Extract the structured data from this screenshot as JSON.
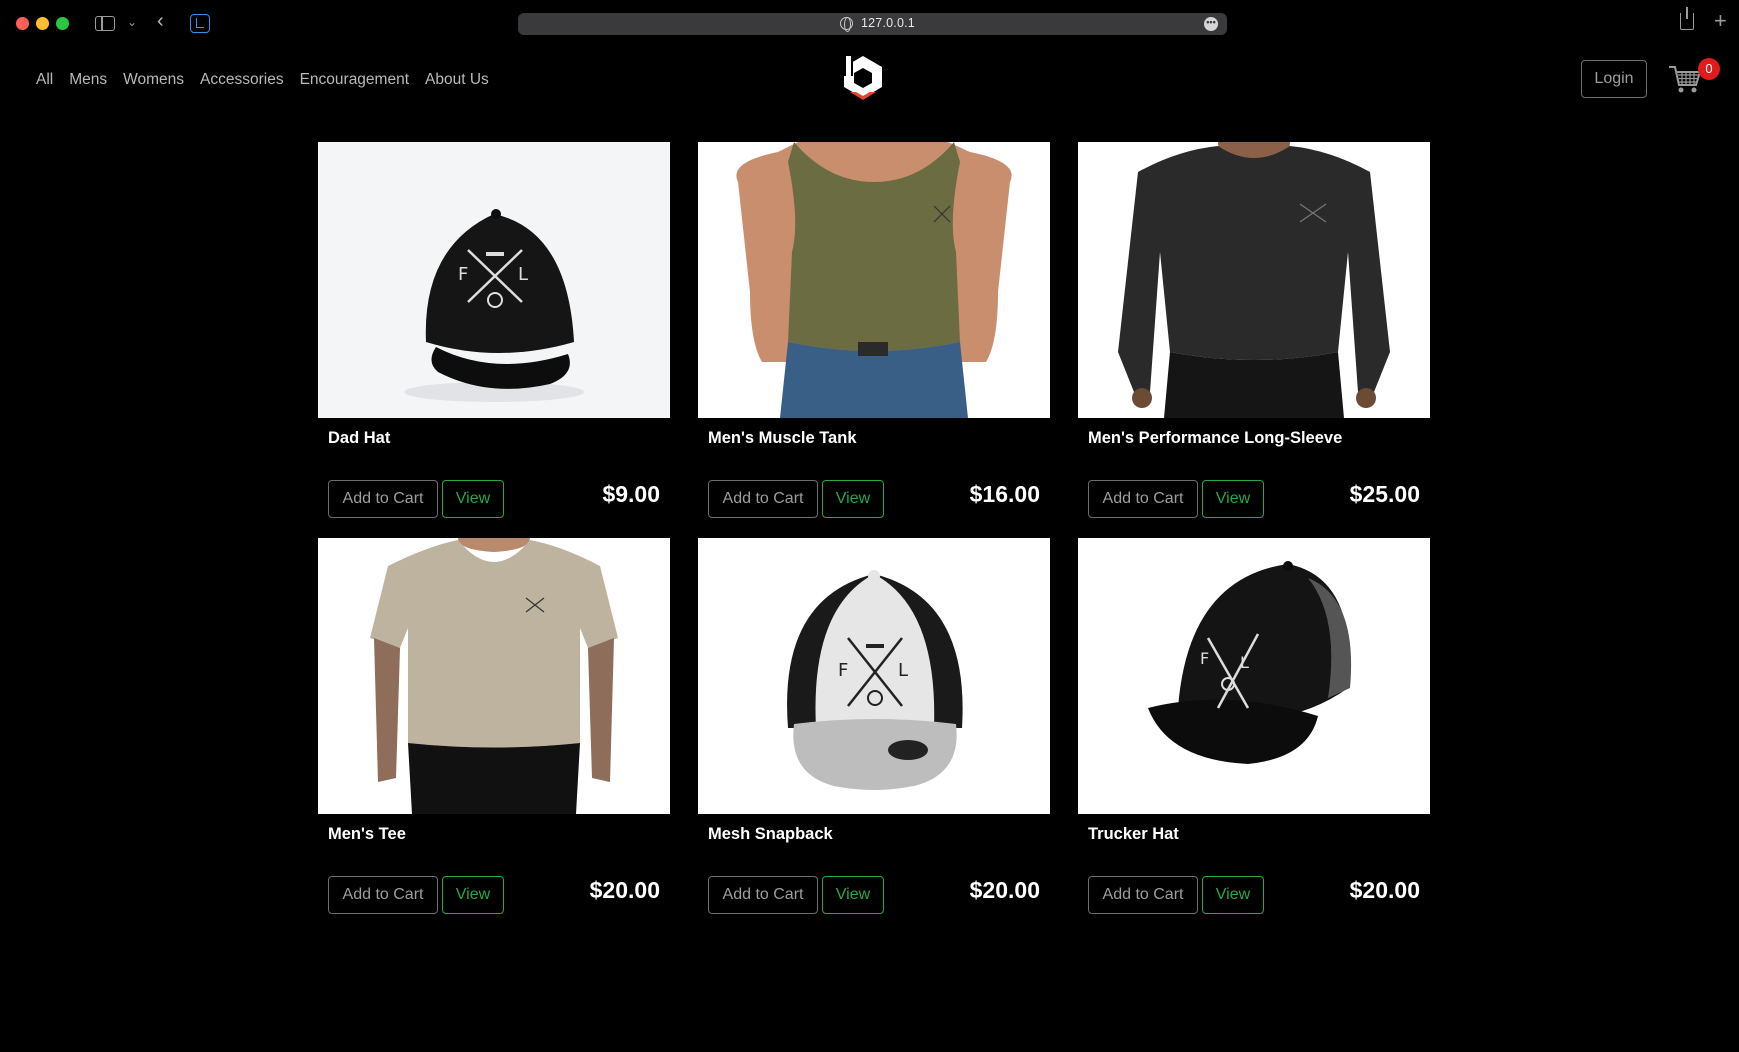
{
  "browser": {
    "url": "127.0.0.1"
  },
  "nav": {
    "links": [
      "All",
      "Mens",
      "Womens",
      "Accessories",
      "Encouragement",
      "About Us"
    ],
    "login_label": "Login",
    "cart_count": "0"
  },
  "products": [
    {
      "name": "Dad Hat",
      "price": "$9.00",
      "add_label": "Add to Cart",
      "view_label": "View",
      "image": "black-dad-hat"
    },
    {
      "name": "Men's Muscle Tank",
      "price": "$16.00",
      "add_label": "Add to Cart",
      "view_label": "View",
      "image": "olive-muscle-tank"
    },
    {
      "name": "Men's Performance Long-Sleeve",
      "price": "$25.00",
      "add_label": "Add to Cart",
      "view_label": "View",
      "image": "black-long-sleeve"
    },
    {
      "name": "Men's Tee",
      "price": "$20.00",
      "add_label": "Add to Cart",
      "view_label": "View",
      "image": "tan-v-neck-tee"
    },
    {
      "name": "Mesh Snapback",
      "price": "$20.00",
      "add_label": "Add to Cart",
      "view_label": "View",
      "image": "grey-mesh-snapback"
    },
    {
      "name": "Trucker Hat",
      "price": "$20.00",
      "add_label": "Add to Cart",
      "view_label": "View",
      "image": "black-trucker-hat"
    }
  ],
  "colors": {
    "background": "#000000",
    "view_accent": "#28a745",
    "badge": "#e01b1b",
    "logo_accent": "#e5452a"
  }
}
